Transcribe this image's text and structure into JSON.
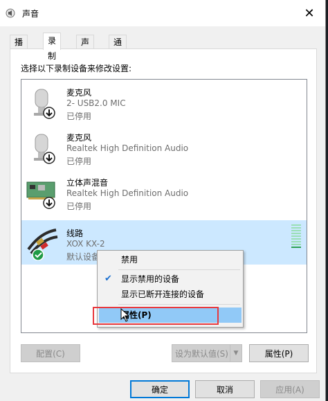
{
  "window": {
    "title": "声音"
  },
  "tabs": [
    {
      "label": "播放"
    },
    {
      "label": "录制"
    },
    {
      "label": "声音"
    },
    {
      "label": "通信"
    }
  ],
  "instruction": "选择以下录制设备来修改设置:",
  "devices": [
    {
      "name": "麦克风",
      "description": "2- USB2.0 MIC",
      "status": "已停用",
      "icon": "microphone-icon"
    },
    {
      "name": "麦克风",
      "description": "Realtek High Definition Audio",
      "status": "已停用",
      "icon": "microphone-icon"
    },
    {
      "name": "立体声混音",
      "description": "Realtek High Definition Audio",
      "status": "已停用",
      "icon": "sound-card-icon"
    },
    {
      "name": "线路",
      "description": "XOX KX-2",
      "status": "默认设备",
      "icon": "rca-cable-icon"
    }
  ],
  "context_menu": {
    "items": [
      {
        "label": "禁用"
      },
      {
        "label": "显示禁用的设备",
        "checked": true
      },
      {
        "label": "显示已断开连接的设备"
      },
      {
        "label": "属性(P)"
      }
    ]
  },
  "panel_buttons": {
    "configure": "配置(C)",
    "set_default": "设为默认值(S)",
    "properties": "属性(P)"
  },
  "footer_buttons": {
    "ok": "确定",
    "cancel": "取消",
    "apply": "应用(A)"
  },
  "colors": {
    "selection": "#cce8ff",
    "menu_highlight": "#91c9f7",
    "annotation_box": "#e8383d",
    "default_badge": "#1f9a45"
  }
}
